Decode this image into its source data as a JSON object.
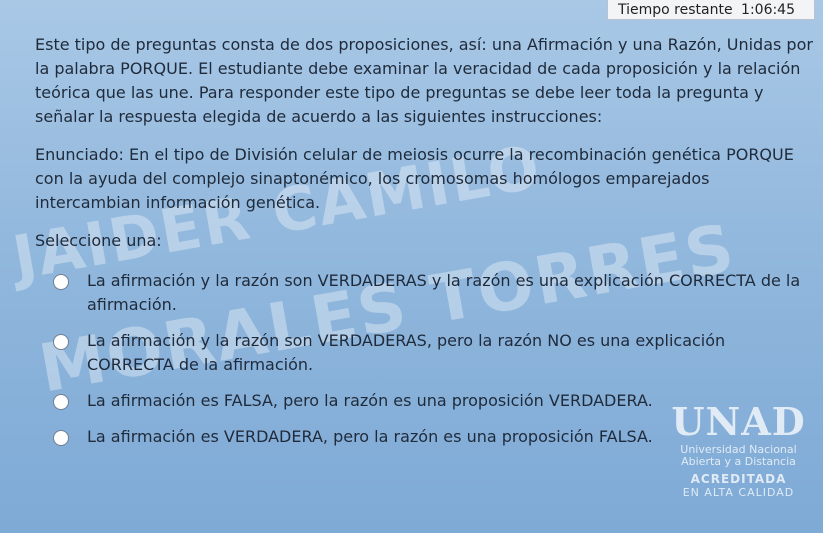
{
  "timer": {
    "label": "Tiempo restante",
    "value": "1:06:45"
  },
  "instructions": "Este tipo de preguntas consta de dos proposiciones, así: una Afirmación y una Razón, Unidas por la palabra PORQUE. El estudiante debe examinar la veracidad de cada proposición y la relación teórica que las une. Para responder este tipo de preguntas se debe leer toda la pregunta y señalar la respuesta elegida de acuerdo a las siguientes instrucciones:",
  "statement": "Enunciado: En el tipo de División celular de meiosis ocurre la recombinación genética PORQUE con la ayuda del complejo sinaptonémico, los cromosomas homólogos emparejados intercambian información genética.",
  "select_label": "Seleccione una:",
  "options": [
    "La afirmación y la razón son VERDADERAS y la razón es una explicación CORRECTA de la afirmación.",
    "La afirmación y la razón son VERDADERAS, pero la razón NO es una explicación CORRECTA de la afirmación.",
    "La afirmación es FALSA, pero la razón es una proposición VERDADERA.",
    "La afirmación es VERDADERA, pero la razón es una proposición FALSA."
  ],
  "watermark": {
    "line1": "JAIDER CAMILO",
    "line2": "MORALES TORRES"
  },
  "logo": {
    "name": "UNAD",
    "sub1": "Universidad Nacional",
    "sub2": "Abierta y a Distancia",
    "acr": "ACREDITADA",
    "cal": "EN ALTA CALIDAD"
  }
}
